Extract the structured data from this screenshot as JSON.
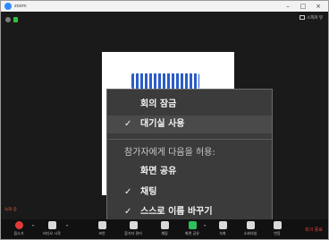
{
  "window": {
    "title": "zoom",
    "minimize": "–",
    "maximize": "□",
    "close": "×"
  },
  "video": {
    "view_label": "스피커 뷰",
    "recording": "녹화 중"
  },
  "menu": {
    "items": [
      {
        "label": "회의 잠금",
        "checked": false
      },
      {
        "label": "대기실 사용",
        "checked": true
      }
    ],
    "section_header": "참가자에게 다음을 허용:",
    "allow_items": [
      {
        "label": "화면 공유",
        "checked": false
      },
      {
        "label": "채팅",
        "checked": true
      },
      {
        "label": "스스로 이름 바꾸기",
        "checked": true
      }
    ],
    "check_glyph": "✓"
  },
  "toolbar": {
    "buttons": [
      {
        "label": "음소거",
        "icon": "microphone-muted-icon",
        "color": "#e23a3a"
      },
      {
        "label": "비디오 시작",
        "icon": "video-camera-icon"
      },
      {
        "label": "보안",
        "icon": "shield-icon"
      },
      {
        "label": "참가자 관리",
        "icon": "participants-icon"
      },
      {
        "label": "채팅",
        "icon": "chat-icon"
      },
      {
        "label": "화면 공유",
        "icon": "share-screen-icon",
        "color": "#2fc05c"
      },
      {
        "label": "녹화",
        "icon": "record-icon"
      },
      {
        "label": "소회의실",
        "icon": "breakout-rooms-icon"
      },
      {
        "label": "반응",
        "icon": "reactions-icon"
      }
    ],
    "end_label": "회의 종료"
  }
}
